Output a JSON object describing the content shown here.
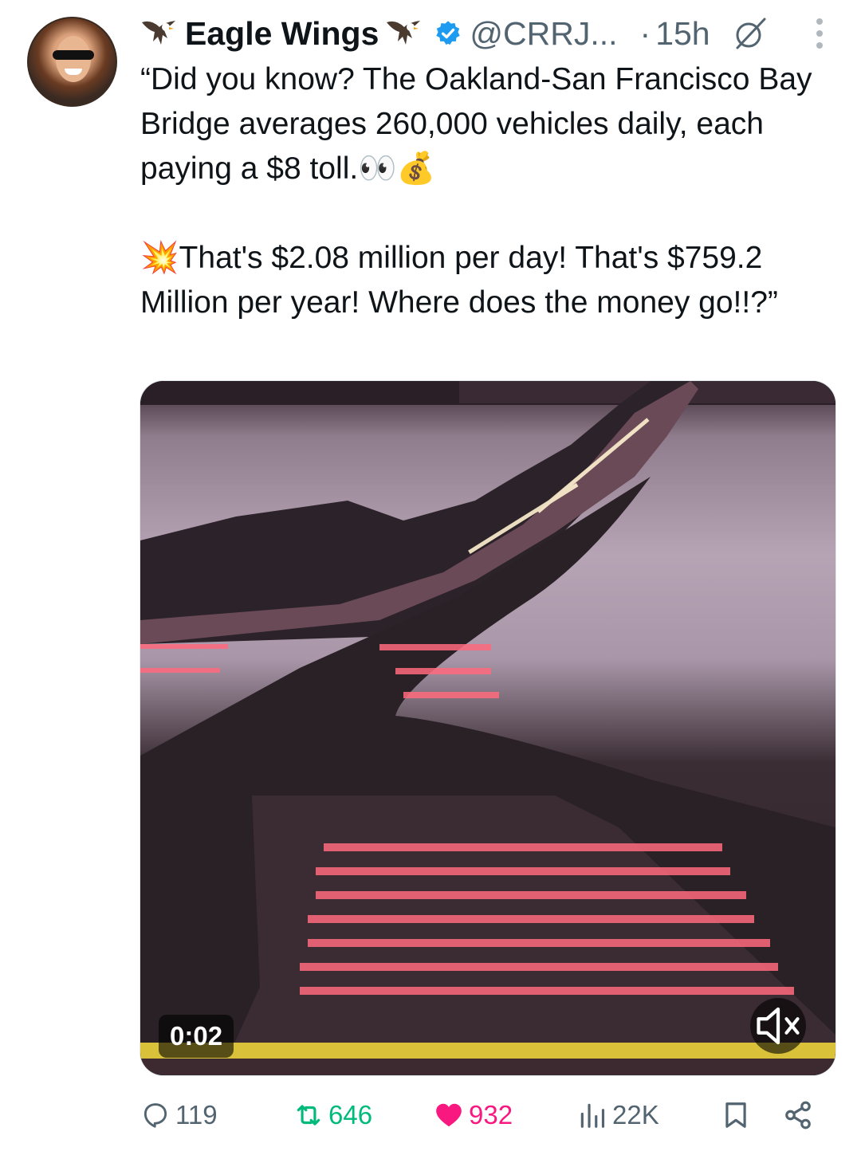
{
  "tweet": {
    "author_name": "Eagle Wings",
    "handle": "@CRRJ...",
    "separator": "·",
    "time": "15h",
    "text": "“Did you know? The Oakland-San Francisco Bay Bridge averages 260,000 vehicles daily, each paying a $8 toll.👀💰\n\n💥That's $2.08 million per day! That's $759.2 Million per year! Where does the money go!!?”"
  },
  "media": {
    "video_time": "0:02",
    "muted": true
  },
  "actions": {
    "replies": "119",
    "reposts": "646",
    "likes": "932",
    "views": "22K"
  },
  "colors": {
    "verified": "#1d9bf0",
    "repost": "#00ba7c",
    "like": "#f91880",
    "secondary_text": "#536471"
  }
}
